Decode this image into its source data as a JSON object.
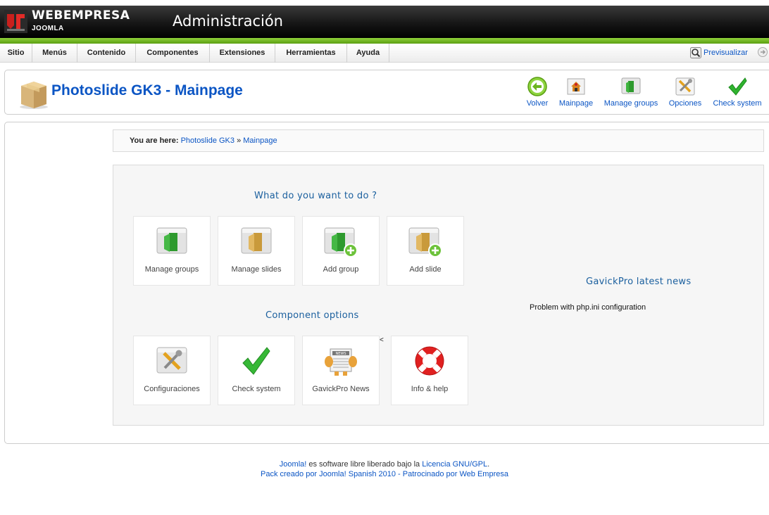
{
  "header": {
    "brand": "WEBEMPRESA",
    "brand_sub": "JOOMLA",
    "title": "Administración"
  },
  "menu": {
    "items": [
      "Sitio",
      "Menús",
      "Contenido",
      "Componentes",
      "Extensiones",
      "Herramientas",
      "Ayuda"
    ],
    "preview_label": "Previsualizar"
  },
  "toolbar": {
    "page_title": "Photoslide GK3 - Mainpage",
    "buttons": {
      "back": "Volver",
      "mainpage": "Mainpage",
      "manage_groups": "Manage groups",
      "options": "Opciones",
      "check_system": "Check system"
    }
  },
  "breadcrumb": {
    "prefix": "You are here:",
    "items": [
      "Photoslide GK3",
      "Mainpage"
    ],
    "separator": "»"
  },
  "main": {
    "actions_heading": "What do you want to do ?",
    "actions": [
      "Manage groups",
      "Manage slides",
      "Add group",
      "Add slide"
    ],
    "options_heading": "Component options",
    "options": [
      "Configuraciones",
      "Check system",
      "GavickPro News",
      "Info & help"
    ],
    "news_heading": "GavickPro latest news",
    "news_item": "Problem with php.ini configuration",
    "stray_mark": "<"
  },
  "footer": {
    "line1_link1": "Joomla!",
    "line1_text": " es software libre liberado bajo la ",
    "line1_link2": "Licencia GNU/GPL",
    "line1_end": ".",
    "line2": "Pack creado por Joomla! Spanish 2010 - Patrocinado por Web Empresa"
  },
  "colors": {
    "accent_blue": "#0b55c4",
    "heading_blue": "#1a5f9e",
    "header_bg": "#161616",
    "green_bar": "#6cb51e"
  },
  "icons": {
    "logo": "joomla-logo-icon",
    "preview": "magnifier-icon",
    "logout": "logout-icon",
    "page": "package-box-icon",
    "back": "back-arrow-icon",
    "mainpage": "home-icon",
    "groups": "green-folder-icon",
    "options": "tools-icon",
    "check": "checkmark-icon",
    "slides": "yellow-folder-icon",
    "add": "plus-icon",
    "news": "newspaper-icon",
    "help": "lifebuoy-icon"
  }
}
